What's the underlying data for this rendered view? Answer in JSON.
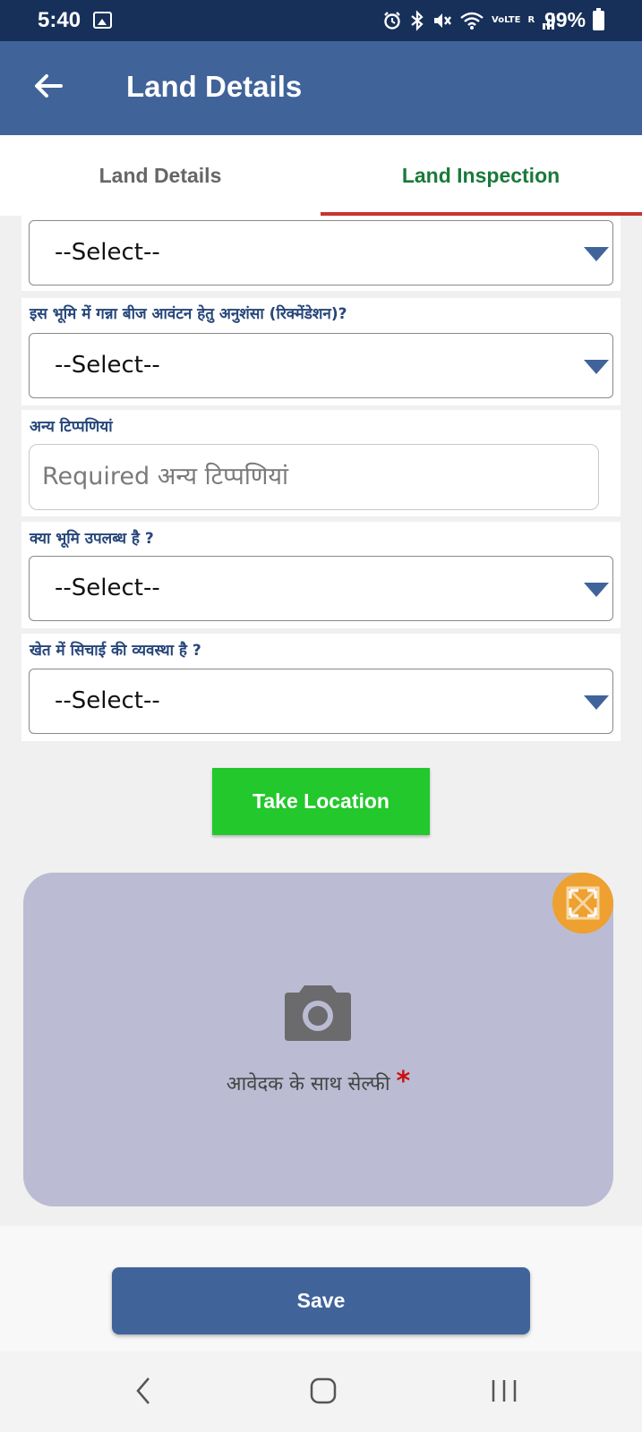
{
  "status_bar": {
    "time": "5:40",
    "gallery_icon": "image-icon",
    "alarm_icon": "alarm-icon",
    "bluetooth_icon": "bluetooth-icon",
    "mute_icon": "mute-icon",
    "wifi_icon": "wifi-icon",
    "network_label_top": "VoLTE",
    "signal_label": "R",
    "battery_percent": "99%"
  },
  "app_bar": {
    "title": "Land Details",
    "back_icon": "arrow-back-icon"
  },
  "tabs": [
    {
      "label": "Land Details",
      "selected": false
    },
    {
      "label": "Land Inspection",
      "selected": true
    }
  ],
  "form": {
    "field_top": {
      "value": "--Select--"
    },
    "recommendation": {
      "label": "इस भूमि में गन्ना  बीज आवंटन हेतु अनुशंसा (रिक्मेंडेशन)?",
      "value": "--Select--"
    },
    "remarks": {
      "label": "अन्य टिप्पणियां",
      "placeholder": "Required अन्य टिप्पणियां"
    },
    "land_available": {
      "label": "क्या भूमि उपलब्ध है ?",
      "value": "--Select--"
    },
    "irrigation": {
      "label": "खेत में सिचाई की व्यवस्था है ?",
      "value": "--Select--"
    }
  },
  "take_location_label": "Take Location",
  "selfie": {
    "label": "आवेदक के साथ सेल्फी",
    "required_mark": "*"
  },
  "save_label": "Save",
  "colors": {
    "app_bar": "#40639a",
    "status_bar": "#17305a",
    "tab_selected": "#1a7a3a",
    "tab_indicator": "#c8342e",
    "take_location": "#22c82c",
    "selfie_panel": "#bbbcd3",
    "expand_button": "#eea030"
  }
}
